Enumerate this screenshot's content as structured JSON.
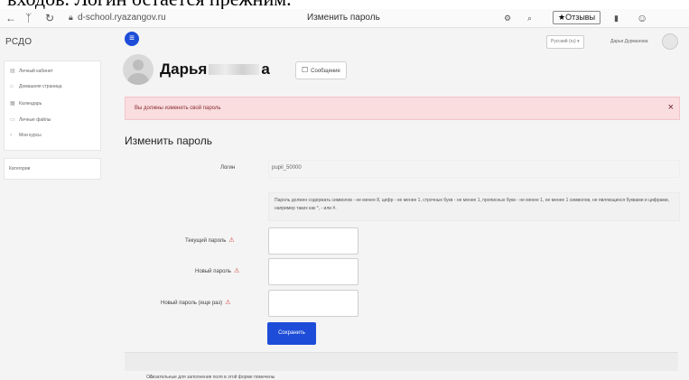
{
  "caption": {
    "text": "входов. Логин остается прежним."
  },
  "browser": {
    "back_icon": "←",
    "bookmark_icon": "ᛉ",
    "reload_icon": "↻",
    "url": "d-school.ryazangov.ru",
    "tab_title": "Изменить пароль",
    "reviews_label": "Отзывы"
  },
  "sidebar": {
    "brand": "РСДО",
    "items": [
      {
        "label": "Личный кабинет",
        "icon": "dashboard-icon"
      },
      {
        "label": "Домашняя страница",
        "icon": "home-icon"
      },
      {
        "label": "Календарь",
        "icon": "calendar-icon"
      },
      {
        "label": "Личные файлы",
        "icon": "files-icon"
      },
      {
        "label": "Мои курсы",
        "icon": "chevron-icon"
      }
    ],
    "categories": "Категории"
  },
  "header": {
    "language": "Русский (ru) ▾",
    "user_name": "Дарья Дурманова"
  },
  "profile": {
    "name_start": "Дарья",
    "name_end": "а",
    "message_button": "Сообщение"
  },
  "alert": {
    "text": "Вы должны изменить свой пароль",
    "close": "×"
  },
  "form": {
    "title": "Изменить пароль",
    "login_label": "Логин",
    "login_value": "pupil_50000",
    "rules_text": "Пароль должен содержать символов - не менее 8, цифр - не менее 1, строчных букв - не менее 1, прописных букв - не менее 1, не менее 1 символов, не являющихся буквами и цифрами, например таких как *, - или #.",
    "current_label": "Текущий пароль",
    "new_label": "Новый пароль",
    "repeat_label": "Новый пароль (еще раз)",
    "required_mark": "⚠",
    "save_label": "Сохранить",
    "footnote": "Обязательные для заполнения поля в этой форме помечены"
  },
  "colors": {
    "accent": "#1d4dd8",
    "alert_bg": "#f9dddf",
    "required": "#d13b3b"
  }
}
